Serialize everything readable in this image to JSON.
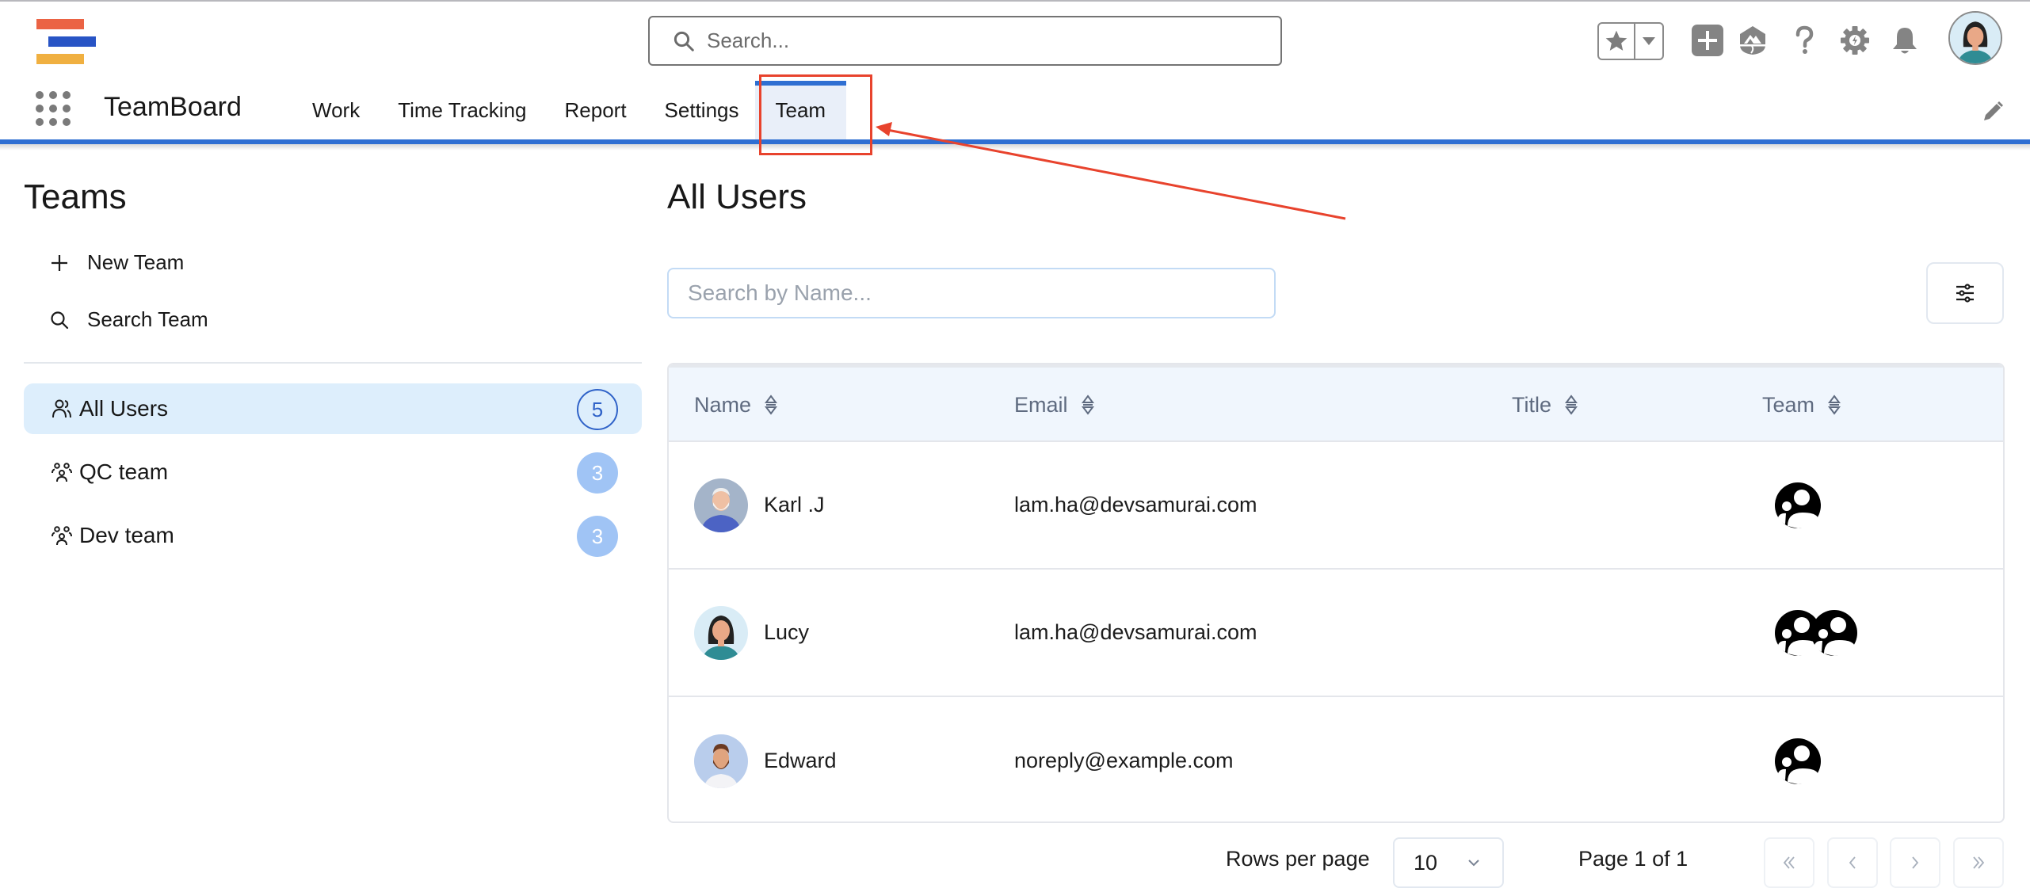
{
  "header": {
    "search_placeholder": "Search...",
    "icons": [
      "star-icon",
      "dropdown-caret-icon",
      "add-icon",
      "trailhead-icon",
      "help-icon",
      "setup-gear-icon",
      "notification-bell-icon",
      "user-avatar"
    ]
  },
  "nav": {
    "app_name": "TeamBoard",
    "items": [
      {
        "label": "Work",
        "active": false
      },
      {
        "label": "Time Tracking",
        "active": false
      },
      {
        "label": "Report",
        "active": false
      },
      {
        "label": "Settings",
        "active": false
      },
      {
        "label": "Team",
        "active": true
      }
    ],
    "accent_color": "#2f6fd2"
  },
  "sidebar": {
    "title": "Teams",
    "actions": [
      {
        "label": "New Team",
        "icon": "plus-icon"
      },
      {
        "label": "Search Team",
        "icon": "search-icon"
      }
    ],
    "teams": [
      {
        "label": "All Users",
        "count": "5",
        "active": true,
        "icon": "users-icon"
      },
      {
        "label": "QC team",
        "count": "3",
        "active": false,
        "icon": "group-icon"
      },
      {
        "label": "Dev team",
        "count": "3",
        "active": false,
        "icon": "group-icon"
      }
    ]
  },
  "main": {
    "title": "All Users",
    "search_placeholder": "Search by Name...",
    "table": {
      "columns": [
        "Name",
        "Email",
        "Title",
        "Team"
      ],
      "rows": [
        {
          "name": "Karl .J",
          "email": "lam.ha@devsamurai.com",
          "title": "",
          "team_count": 1
        },
        {
          "name": "Lucy",
          "email": "lam.ha@devsamurai.com",
          "title": "",
          "team_count": 2
        },
        {
          "name": "Edward",
          "email": "noreply@example.com",
          "title": "",
          "team_count": 1
        }
      ]
    },
    "pagination": {
      "rows_per_page_label": "Rows per page",
      "rows_per_page": "10",
      "page_info": "Page 1 of 1"
    }
  },
  "annotation": {
    "color": "#e8432d",
    "target": "Team tab"
  }
}
